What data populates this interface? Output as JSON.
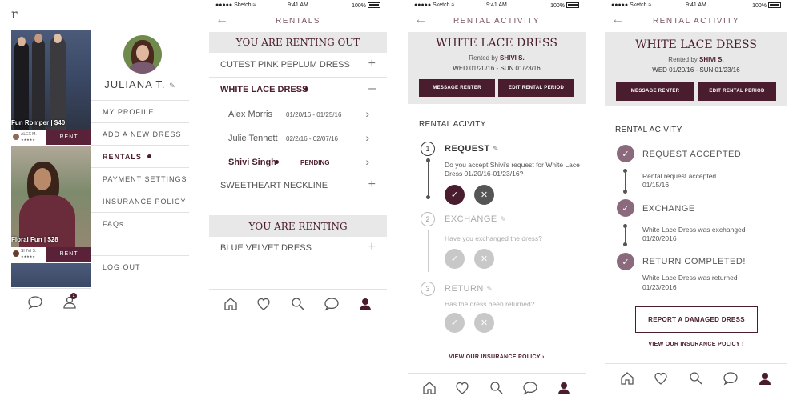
{
  "status": {
    "carrier": "Sketch",
    "time": "9:41 AM",
    "battery": "100%"
  },
  "screen1": {
    "cards": [
      {
        "caption": "Fun Romper | $40",
        "owner": "ALEX M.",
        "rent": "RENT"
      },
      {
        "caption": "Floral Fun | $28",
        "owner": "SHIVI S.",
        "rent": "RENT"
      }
    ],
    "user_name": "JULIANA T.",
    "menu": [
      "MY PROFILE",
      "ADD A NEW DRESS",
      "RENTALS",
      "PAYMENT SETTINGS",
      "INSURANCE POLICY",
      "FAQs"
    ],
    "logout": "LOG OUT",
    "badge": "1",
    "colors": {
      "accent": "#4a1d2e"
    }
  },
  "screen2": {
    "title": "RENTALS",
    "out_header": "YOU ARE RENTING OUT",
    "items": [
      {
        "label": "CUTEST PINK PEPLUM DRESS",
        "toggle": "+"
      },
      {
        "label": "WHITE LACE DRESS",
        "toggle": "–"
      }
    ],
    "renters": [
      {
        "name": "Alex Morris",
        "dates": "01/20/16 - 01/25/16"
      },
      {
        "name": "Julie Tennett",
        "dates": "02/2/16 - 02/07/16"
      },
      {
        "name": "Shivi Singh",
        "status": "PENDING"
      }
    ],
    "item_last": {
      "label": "SWEETHEART NECKLINE",
      "toggle": "+"
    },
    "in_header": "YOU ARE RENTING",
    "in_items": [
      {
        "label": "BLUE VELVET DRESS",
        "toggle": "+"
      }
    ]
  },
  "screen3": {
    "title": "RENTAL ACTIVITY",
    "dress": "WHITE LACE DRESS",
    "rented_by_prefix": "Rented by",
    "renter": "SHIVI S.",
    "dates": "WED 01/20/16 - SUN 01/23/16",
    "message_btn": "MESSAGE RENTER",
    "edit_btn": "EDIT RENTAL PERIOD",
    "section": "RENTAL ACIVITY",
    "steps": [
      {
        "num": "1",
        "label": "REQUEST",
        "question": "Do you accept Shivi's request for White Lace Dress 01/20/16-01/23/16?"
      },
      {
        "num": "2",
        "label": "EXCHANGE",
        "question": "Have you exchanged the dress?"
      },
      {
        "num": "3",
        "label": "RETURN",
        "question": "Has the dress been returned?"
      }
    ],
    "insurance_link": "VIEW OUR INSURANCE POLICY"
  },
  "screen4": {
    "title": "RENTAL ACTIVITY",
    "dress": "WHITE LACE DRESS",
    "rented_by_prefix": "Rented by",
    "renter": "SHIVI S.",
    "dates": "WED 01/20/16 - SUN 01/23/16",
    "message_btn": "MESSAGE RENTER",
    "edit_btn": "EDIT RENTAL PERIOD",
    "section": "RENTAL ACIVITY",
    "steps": [
      {
        "label": "REQUEST ACCEPTED",
        "detail": "Rental request accepted",
        "date": "01/15/16"
      },
      {
        "label": "EXCHANGE",
        "detail": "White Lace Dress was exchanged",
        "date": "01/20/2016"
      },
      {
        "label": "RETURN COMPLETED!",
        "detail": "White Lace Dress was returned",
        "date": "01/23/2016"
      }
    ],
    "damage_btn": "REPORT A DAMAGED DRESS",
    "insurance_link": "VIEW OUR INSURANCE POLICY"
  }
}
